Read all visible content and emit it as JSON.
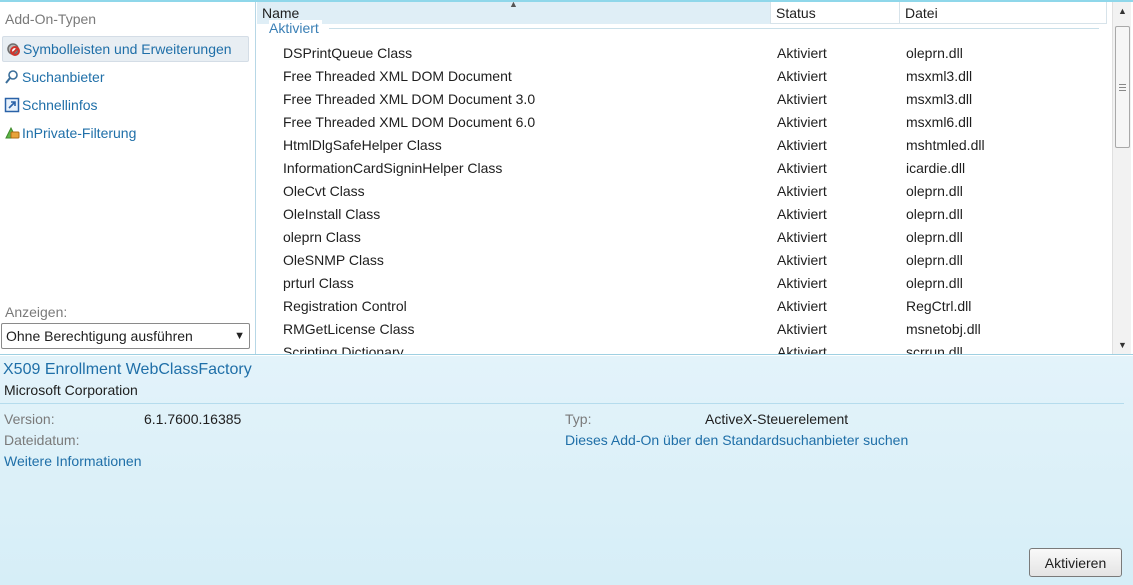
{
  "sidebar": {
    "heading": "Add-On-Typen",
    "items": [
      {
        "label": "Symbolleisten und Erweiterungen",
        "icon": "gear-icon",
        "selected": true
      },
      {
        "label": "Suchanbieter",
        "icon": "search-icon",
        "selected": false
      },
      {
        "label": "Schnellinfos",
        "icon": "accelerator-icon",
        "selected": false
      },
      {
        "label": "InPrivate-Filterung",
        "icon": "inprivate-icon",
        "selected": false
      }
    ],
    "show_label": "Anzeigen:",
    "show_value": "Ohne Berechtigung ausführen"
  },
  "list": {
    "columns": {
      "name": "Name",
      "status": "Status",
      "file": "Datei"
    },
    "group_label": "Aktiviert",
    "rows": [
      {
        "name": "DSPrintQueue Class",
        "status": "Aktiviert",
        "file": "oleprn.dll"
      },
      {
        "name": "Free Threaded XML DOM Document",
        "status": "Aktiviert",
        "file": "msxml3.dll"
      },
      {
        "name": "Free Threaded XML DOM Document 3.0",
        "status": "Aktiviert",
        "file": "msxml3.dll"
      },
      {
        "name": "Free Threaded XML DOM Document 6.0",
        "status": "Aktiviert",
        "file": "msxml6.dll"
      },
      {
        "name": "HtmlDlgSafeHelper Class",
        "status": "Aktiviert",
        "file": "mshtmled.dll"
      },
      {
        "name": "InformationCardSigninHelper Class",
        "status": "Aktiviert",
        "file": "icardie.dll"
      },
      {
        "name": "OleCvt Class",
        "status": "Aktiviert",
        "file": "oleprn.dll"
      },
      {
        "name": "OleInstall Class",
        "status": "Aktiviert",
        "file": "oleprn.dll"
      },
      {
        "name": "oleprn Class",
        "status": "Aktiviert",
        "file": "oleprn.dll"
      },
      {
        "name": "OleSNMP Class",
        "status": "Aktiviert",
        "file": "oleprn.dll"
      },
      {
        "name": "prturl Class",
        "status": "Aktiviert",
        "file": "oleprn.dll"
      },
      {
        "name": "Registration Control",
        "status": "Aktiviert",
        "file": "RegCtrl.dll"
      },
      {
        "name": "RMGetLicense Class",
        "status": "Aktiviert",
        "file": "msnetobj.dll"
      },
      {
        "name": "Scripting Dictionary",
        "status": "Aktiviert",
        "file": "scrrun.dll"
      }
    ]
  },
  "details": {
    "title": "X509 Enrollment WebClassFactory",
    "company": "Microsoft Corporation",
    "version_label": "Version:",
    "version_value": "6.1.7600.16385",
    "date_label": "Dateidatum:",
    "more_info": "Weitere Informationen",
    "type_label": "Typ:",
    "type_value": "ActiveX-Steuerelement",
    "search_link": "Dieses Add-On über den Standardsuchanbieter suchen",
    "activate_button": "Aktivieren"
  },
  "colors": {
    "link": "#1f6fa8",
    "details_bg": "#dff1f8",
    "accent_line": "#8fd7ea"
  }
}
